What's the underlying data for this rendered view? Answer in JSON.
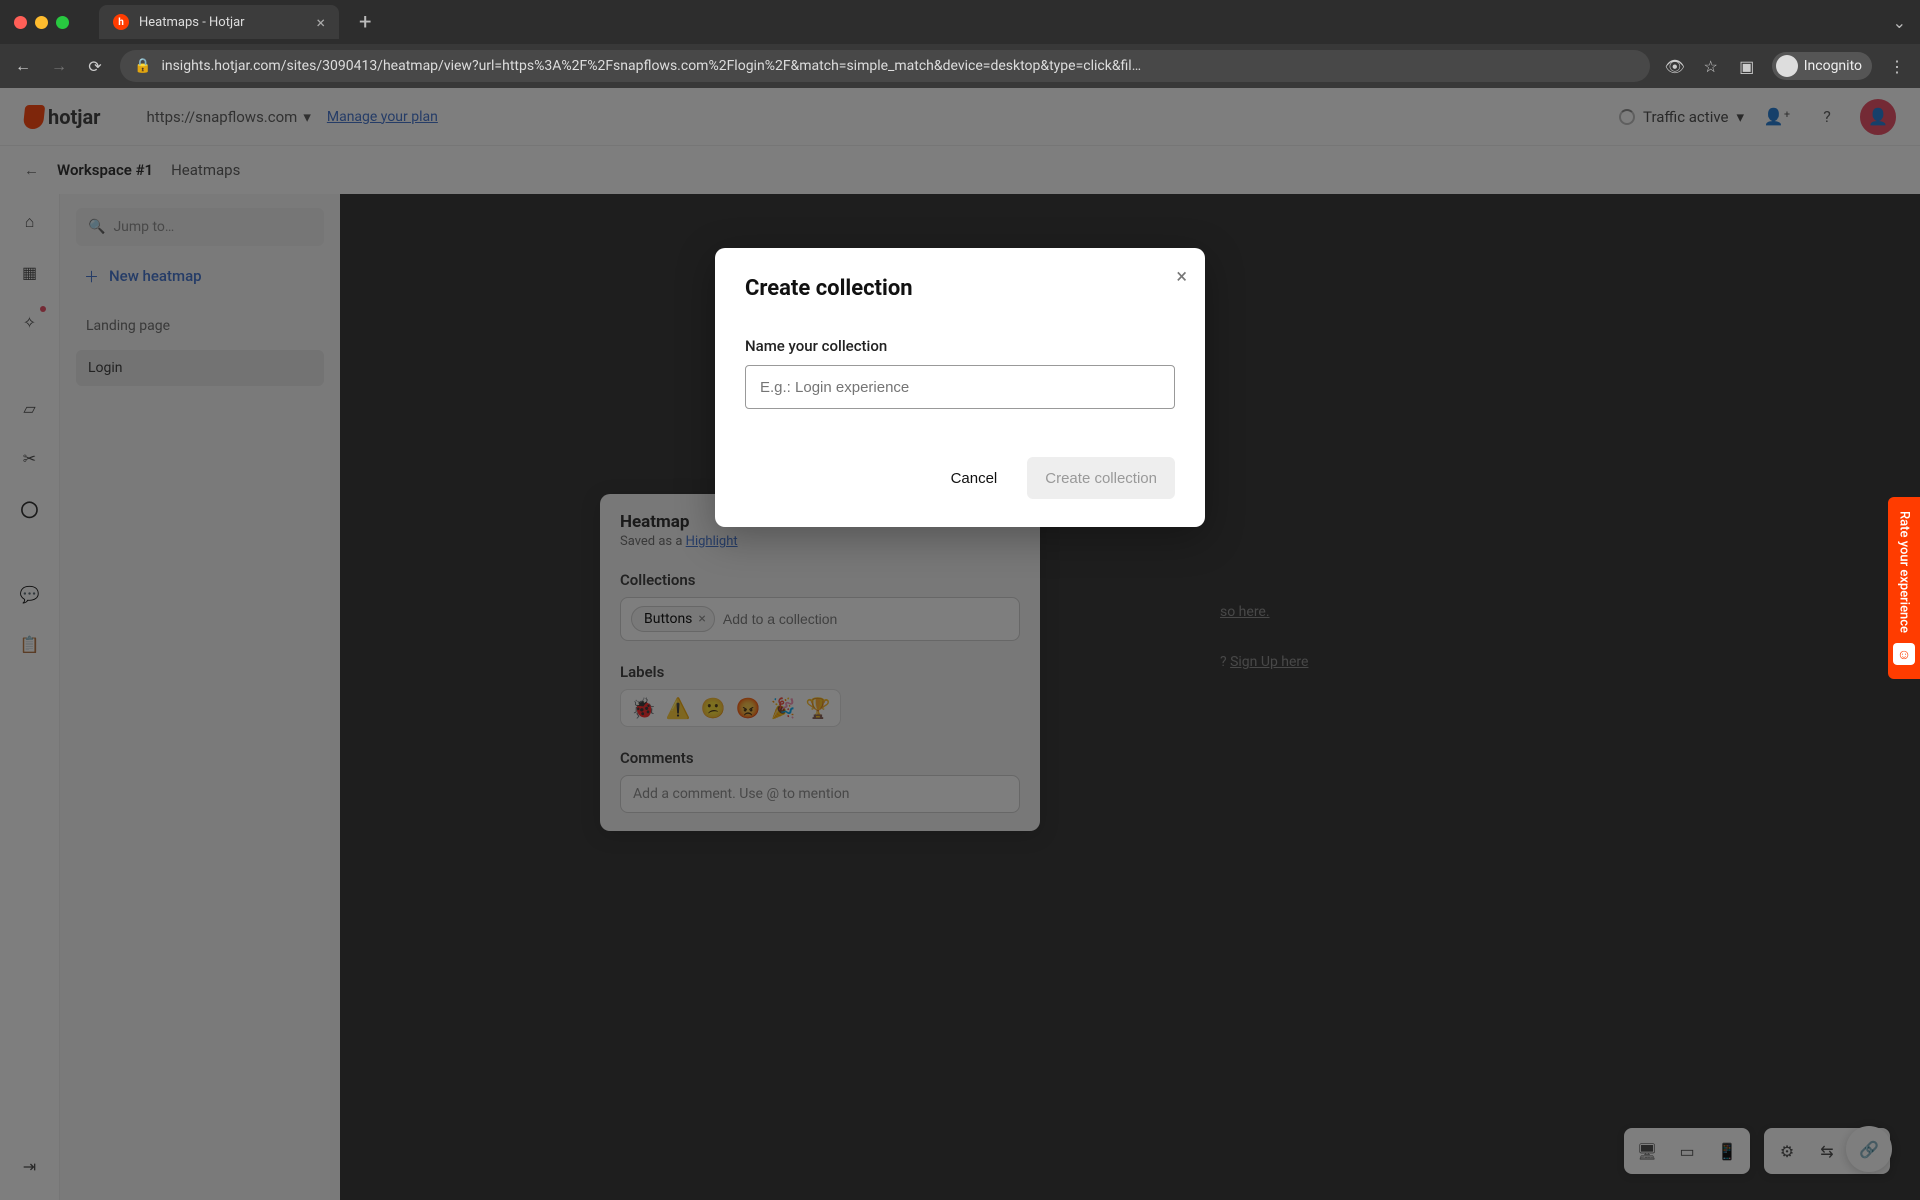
{
  "browser": {
    "tab_title": "Heatmaps - Hotjar",
    "url": "insights.hotjar.com/sites/3090413/heatmap/view?url=https%3A%2F%2Fsnapflows.com%2Flogin%2F&match=simple_match&device=desktop&type=click&fil…",
    "incognito_label": "Incognito"
  },
  "topbar": {
    "brand": "hotjar",
    "site_url": "https://snapflows.com",
    "manage_plan": "Manage your plan",
    "traffic_status": "Traffic active"
  },
  "breadcrumb": {
    "workspace": "Workspace #1",
    "section": "Heatmaps"
  },
  "sidebar": {
    "jump_placeholder": "Jump to…",
    "new_heatmap": "New heatmap",
    "group_label": "Landing page",
    "items": [
      {
        "label": "Login",
        "active": true
      }
    ]
  },
  "panel": {
    "title": "Heatmap",
    "saved_as": "Saved as a ",
    "saved_link": "Highlight",
    "collections_label": "Collections",
    "chip": "Buttons",
    "collection_placeholder": "Add to a collection",
    "labels_label": "Labels",
    "emojis": [
      "🐞",
      "⚠️",
      "😕",
      "😡",
      "🎉",
      "🏆"
    ],
    "comments_label": "Comments",
    "comment_placeholder": "Add a comment. Use @ to mention"
  },
  "bg": {
    "line1": "so here.",
    "signup_q": "? ",
    "signup_link": "Sign Up here"
  },
  "modal": {
    "title": "Create collection",
    "field_label": "Name your collection",
    "placeholder": "E.g.: Login experience",
    "value": "",
    "cancel": "Cancel",
    "submit": "Create collection"
  },
  "feedback": {
    "label": "Rate your experience"
  }
}
